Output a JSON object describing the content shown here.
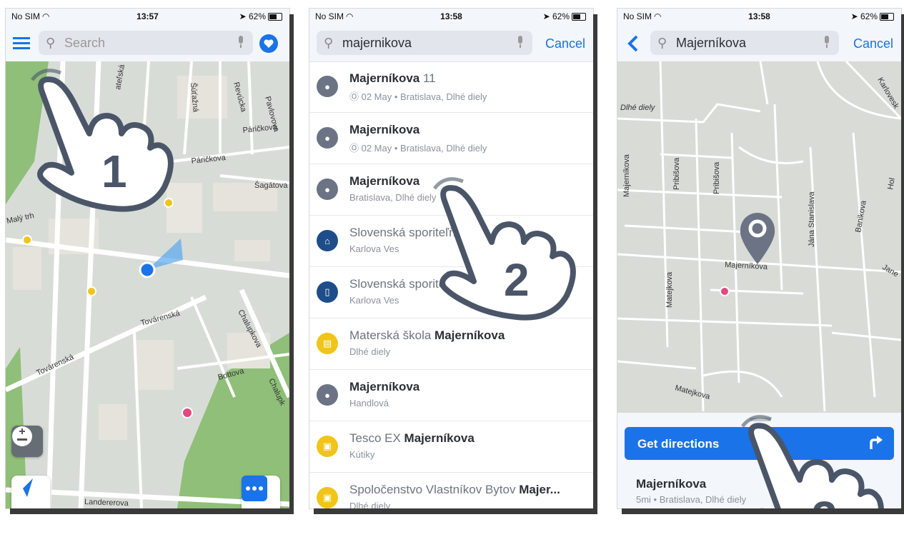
{
  "colors": {
    "accent": "#1a73e8",
    "pin": "#6b7385",
    "bank": "#1d4e89",
    "yellow": "#f0c419",
    "map_bg": "#d8dcd7",
    "green": "#8fbf78"
  },
  "status_bars": [
    {
      "carrier": "No SIM",
      "time": "13:57",
      "battery": "62%"
    },
    {
      "carrier": "No SIM",
      "time": "13:58",
      "battery": "62%"
    },
    {
      "carrier": "No SIM",
      "time": "13:58",
      "battery": "62%"
    }
  ],
  "screen1": {
    "search_placeholder": "Search",
    "step_number": "1",
    "icons": {
      "menu": "hamburger-menu-icon",
      "favorites": "heart-icon",
      "zoom": "zoom-plus-minus-icon",
      "locate": "navigation-arrow-icon",
      "more": "more-dots-icon"
    },
    "street_labels": [
      "Pavlovova",
      "Revúcka",
      "Šúťažná",
      "Páričkova",
      "Páričkova",
      "Šagátova",
      "Malý trh",
      "Továrenská",
      "Továrenská",
      "Chalupkova",
      "Bottova",
      "Chalupk",
      "Landererova",
      "ateľská"
    ]
  },
  "screen2": {
    "search_value": "majernikova",
    "cancel_label": "Cancel",
    "step_number": "2",
    "results": [
      {
        "icon": "pin-icon",
        "title_bold": "Majerníkova",
        "title_light": " 11",
        "subtitle": "Ⓞ 02 May • Bratislava, Dlhé diely"
      },
      {
        "icon": "pin-icon",
        "title_bold": "Majerníkova",
        "title_light": "",
        "subtitle": "Ⓞ 02 May • Bratislava, Dlhé diely"
      },
      {
        "icon": "pin-icon",
        "title_bold": "Majerníkova",
        "title_light": "",
        "subtitle": "Bratislava, Dlhé diely"
      },
      {
        "icon": "bank-icon",
        "title_bold": "",
        "title_light": "Slovenská sporiteľňa",
        "subtitle": "Karlova Ves"
      },
      {
        "icon": "atm-icon",
        "title_bold": "",
        "title_light": "Slovenská sporiteľňa",
        "subtitle": "Karlova Ves"
      },
      {
        "icon": "school-icon",
        "title_bold": "Majerníkova",
        "title_light": "Materská škola ",
        "subtitle": "Dlhé diely",
        "light_first": true
      },
      {
        "icon": "pin-icon",
        "title_bold": "Majerníkova",
        "title_light": "",
        "subtitle": "Handlová"
      },
      {
        "icon": "shop-icon",
        "title_bold": "Majerníkova",
        "title_light": "Tesco EX ",
        "subtitle": "Kútiky",
        "light_first": true
      },
      {
        "icon": "shop-icon",
        "title_bold": "Majer...",
        "title_light": "Spoločenstvo Vlastníkov Bytov ",
        "subtitle": "Dlhé diely",
        "light_first": true
      }
    ]
  },
  "screen3": {
    "search_value": "Majerníkova",
    "cancel_label": "Cancel",
    "step_number": "3",
    "directions_label": "Get directions",
    "place_title": "Majerníkova",
    "place_subtitle": "5mi • Bratislava, Dlhé diely",
    "street_labels": [
      "Dlhé diely",
      "Majerníkova",
      "Pribišova",
      "Pribišova",
      "Jána Stanislava",
      "Banikova",
      "Karlovesk",
      "Majerníkova",
      "Matejkova",
      "Matejkova",
      "Hol",
      "Jane"
    ]
  }
}
